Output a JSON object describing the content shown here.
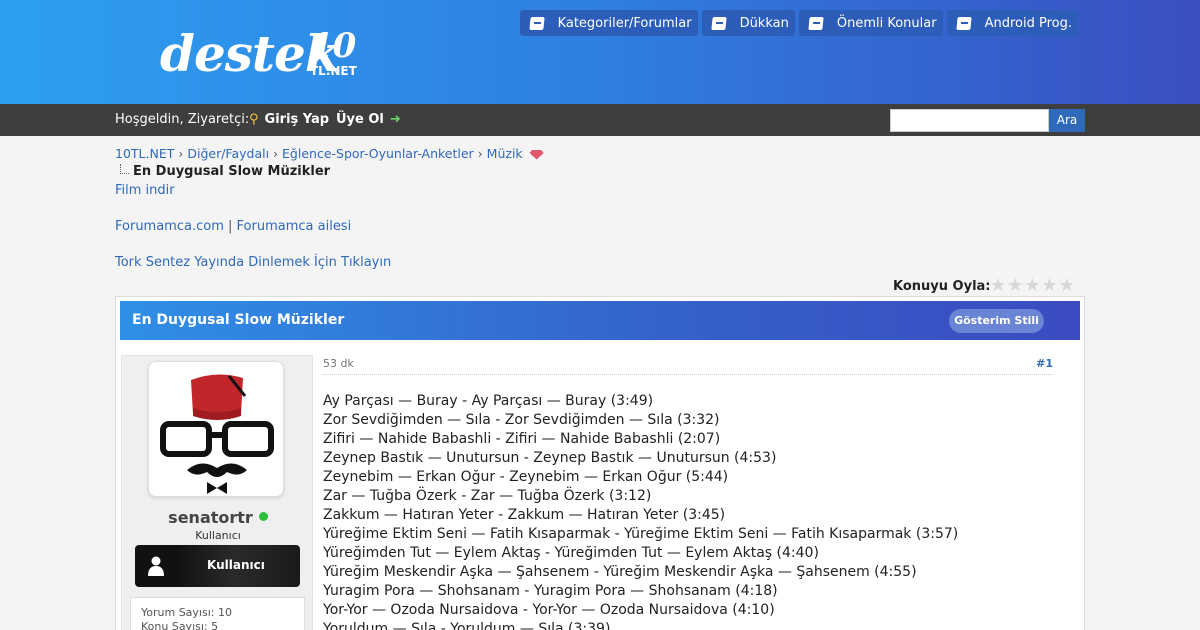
{
  "header": {
    "logo": {
      "text": "destek",
      "num": "10",
      "sub": "TL.NET"
    },
    "nav": [
      {
        "label": "Kategoriler/Forumlar",
        "icon": "book-icon"
      },
      {
        "label": "Dükkan",
        "icon": "book-icon"
      },
      {
        "label": "Önemli Konular",
        "icon": "book-icon"
      },
      {
        "label": "Android Prog.",
        "icon": "book-icon"
      }
    ]
  },
  "userbar": {
    "welcome": "Hoşgeldin, Ziyaretçi:",
    "login": "Giriş Yap",
    "register": "Üye Ol",
    "search_value": "",
    "search_button": "Ara"
  },
  "breadcrumb": {
    "items": [
      "10TL.NET",
      "Diğer/Faydalı",
      "Eğlence-Spor-Oyunlar-Anketler",
      "Müzik"
    ],
    "current": "En Duygusal Slow Müzikler"
  },
  "links": {
    "film": "Film indir",
    "forumamca": "Forumamca.com",
    "forumamca_family": "Forumamca ailesi",
    "tork": "Tork Sentez Yayında Dinlemek İçin Tıklayın"
  },
  "rating": {
    "label": "Konuyu Oyla:",
    "stars": 5
  },
  "thread": {
    "title": "En Duygusal Slow Müzikler",
    "style_button": "Gösterim Stili"
  },
  "user": {
    "name": "senatortr",
    "role": "Kullanıcı",
    "rank": "Kullanıcı",
    "stats": [
      "Yorum Sayısı: 10",
      "Konu Sayısı: 5"
    ]
  },
  "post": {
    "date": "53 dk",
    "number": "#1",
    "songs": [
      "Ay Parçası — Buray - Ay Parçası — Buray (3:49)",
      "Zor Sevdiğimden — Sıla - Zor Sevdiğimden — Sıla (3:32)",
      "Zifiri — Nahide Babashli - Zifiri — Nahide Babashli (2:07)",
      "Zeynep Bastık — Unutursun - Zeynep Bastık — Unutursun (4:53)",
      "Zeynebim — Erkan Oğur - Zeynebim — Erkan Oğur (5:44)",
      "Zar — Tuğba Özerk - Zar — Tuğba Özerk (3:12)",
      "Zakkum — Hatıran Yeter - Zakkum — Hatıran Yeter (3:45)",
      "Yüreğime Ektim Seni — Fatih Kısaparmak - Yüreğime Ektim Seni — Fatih Kısaparmak (3:57)",
      "Yüreğimden Tut — Eylem Aktaş - Yüreğimden Tut — Eylem Aktaş (4:40)",
      "Yüreğim Meskendir Aşka — Şahsenem - Yüreğim Meskendir Aşka — Şahsenem (4:55)",
      "Yuragim Pora — Shohsanam - Yuragim Pora — Shohsanam (4:18)",
      "Yor-Yor — Ozoda Nursaidova - Yor-Yor — Ozoda Nursaidova (4:10)",
      "Yoruldum — Sıla - Yoruldum — Sıla (3:39)"
    ]
  }
}
